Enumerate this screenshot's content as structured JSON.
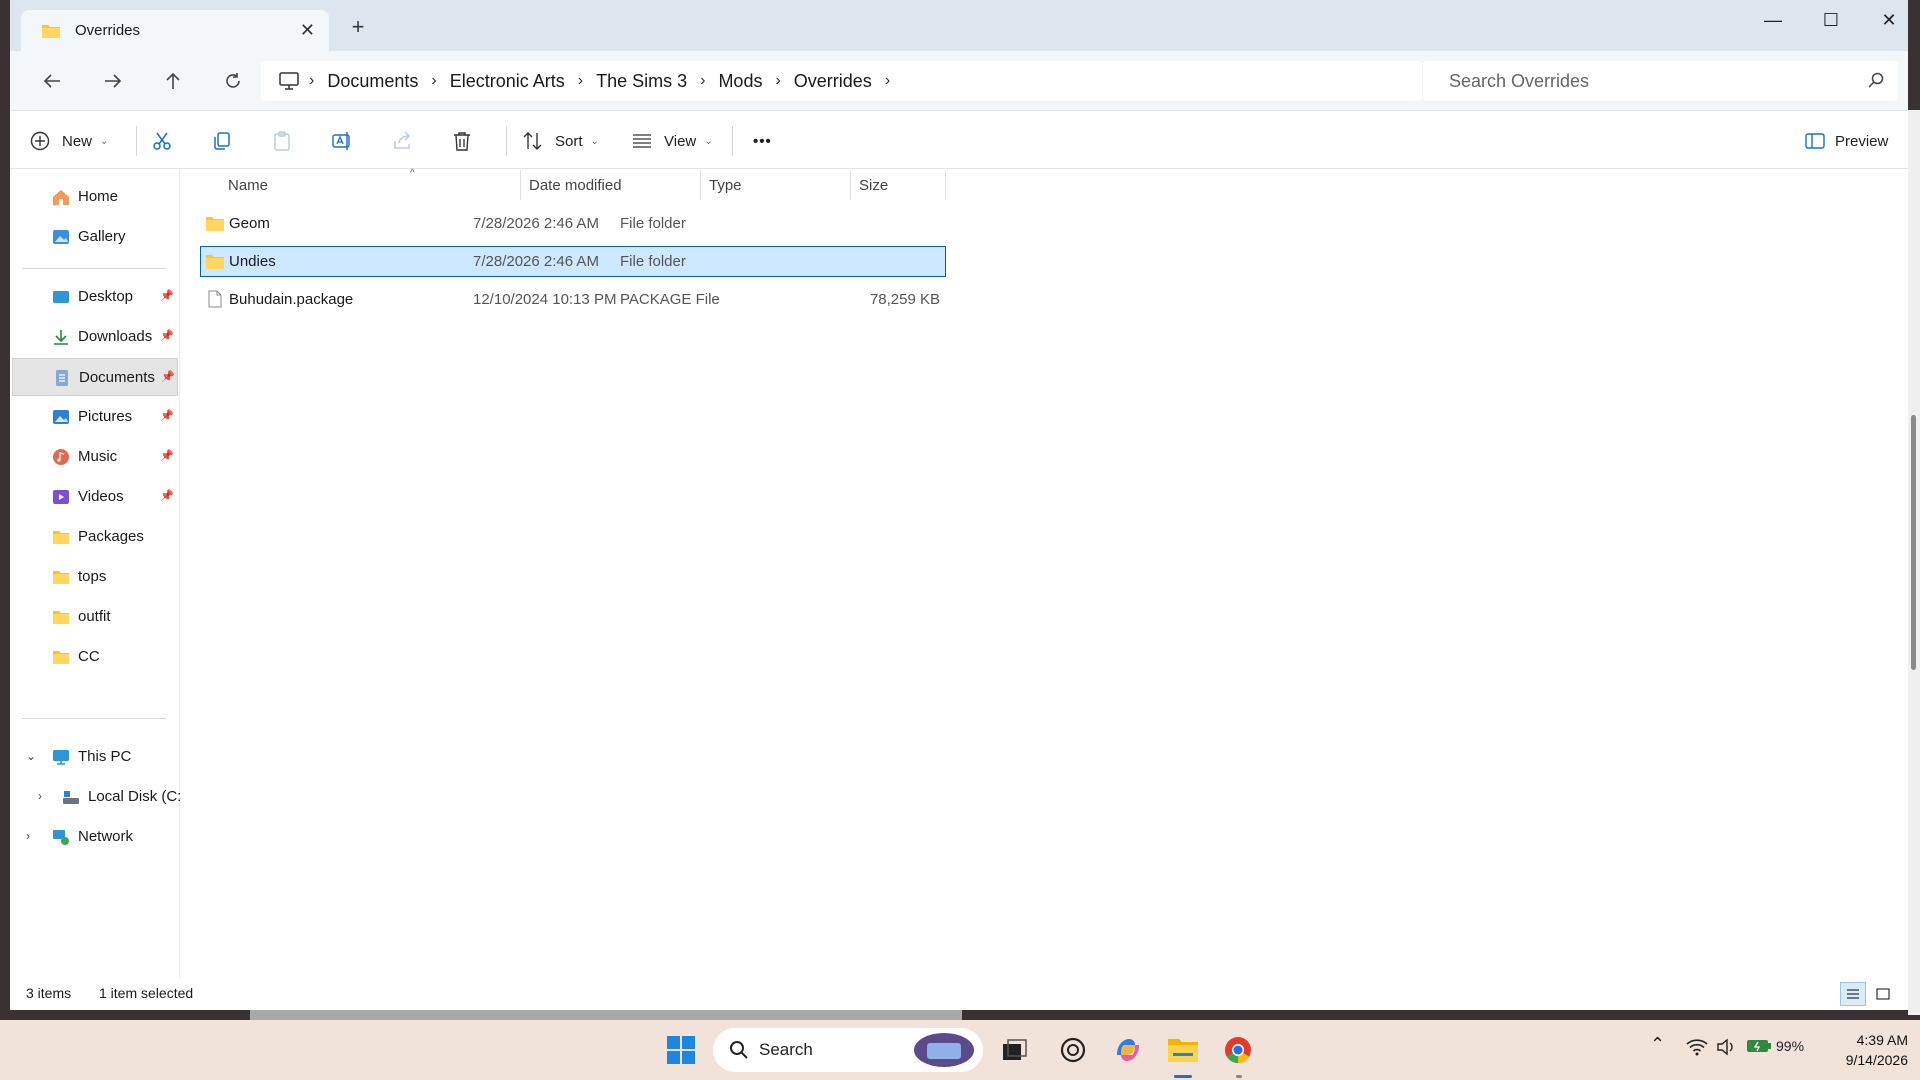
{
  "window": {
    "tab_title": "Overrides",
    "new_tab": "+",
    "controls": {
      "minimize": "—",
      "maximize": "☐",
      "close": "✕"
    }
  },
  "address": {
    "crumbs": [
      "Documents",
      "Electronic Arts",
      "The Sims 3",
      "Mods",
      "Overrides"
    ],
    "search_placeholder": "Search Overrides"
  },
  "toolbar": {
    "new_label": "New",
    "sort_label": "Sort",
    "view_label": "View",
    "more_label": "•••",
    "preview_label": "Preview"
  },
  "sidebar": {
    "quick": [
      {
        "label": "Home",
        "icon": "home-icon"
      },
      {
        "label": "Gallery",
        "icon": "gallery-icon"
      }
    ],
    "pinned": [
      {
        "label": "Desktop",
        "icon": "desktop-icon",
        "pinned": true
      },
      {
        "label": "Downloads",
        "icon": "downloads-icon",
        "pinned": true
      },
      {
        "label": "Documents",
        "icon": "documents-icon",
        "pinned": true,
        "selected": true
      },
      {
        "label": "Pictures",
        "icon": "pictures-icon",
        "pinned": true
      },
      {
        "label": "Music",
        "icon": "music-icon",
        "pinned": true
      },
      {
        "label": "Videos",
        "icon": "videos-icon",
        "pinned": true
      },
      {
        "label": "Packages",
        "icon": "folder-icon"
      },
      {
        "label": "tops",
        "icon": "folder-icon"
      },
      {
        "label": "outfit",
        "icon": "folder-icon"
      },
      {
        "label": "CC",
        "icon": "folder-icon"
      }
    ],
    "this_pc": "This PC",
    "local_disk": "Local Disk (C:",
    "network": "Network"
  },
  "columns": {
    "name": "Name",
    "date": "Date modified",
    "type": "Type",
    "size": "Size"
  },
  "files": [
    {
      "name": "Geom",
      "date": "7/28/2026 2:46 AM",
      "type": "File folder",
      "size": "",
      "icon": "folder-icon",
      "selected": false
    },
    {
      "name": "Undies",
      "date": "7/28/2026 2:46 AM",
      "type": "File folder",
      "size": "",
      "icon": "folder-icon",
      "selected": true
    },
    {
      "name": "Buhudain.package",
      "date": "12/10/2024 10:13 PM",
      "type": "PACKAGE File",
      "size": "78,259 KB",
      "icon": "file-icon",
      "selected": false
    }
  ],
  "status": {
    "count": "3 items",
    "selection": "1 item selected"
  },
  "taskbar": {
    "search_label": "Search",
    "battery": "99%",
    "time": "4:39 AM",
    "date": "9/14/2026"
  },
  "colors": {
    "accent": "#0a5ea8",
    "selection": "#cde8ff",
    "folder": "#f8c43c",
    "titlebar": "#dde6ef"
  }
}
